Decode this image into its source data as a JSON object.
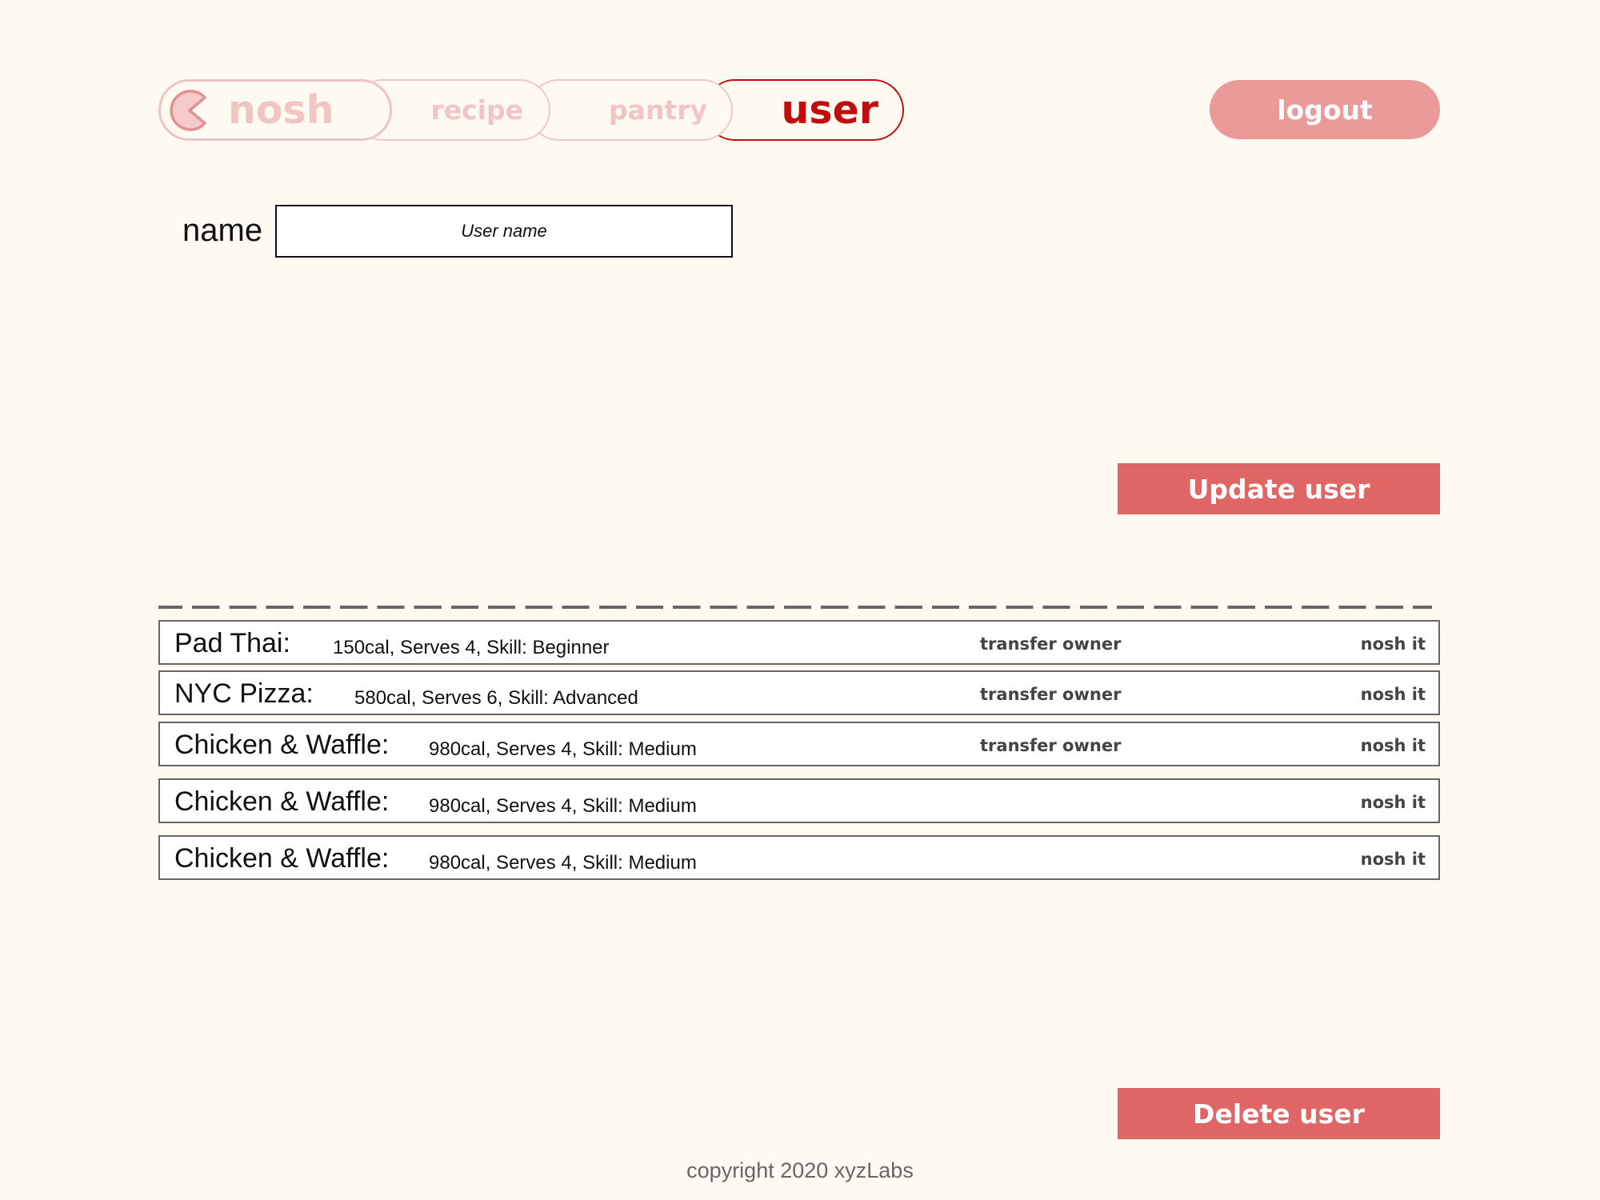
{
  "nav": {
    "home_label": "nosh",
    "recipe_label": "recipe",
    "pantry_label": "pantry",
    "user_label": "user",
    "logo_icon": "pacman-logo-icon",
    "active_color": "#c10d0d",
    "inactive_color": "#f2c5c5"
  },
  "header": {
    "logout_label": "logout",
    "logout_color": "#eb9a9a"
  },
  "form": {
    "name_label": "name",
    "name_placeholder": "User name",
    "name_value": ""
  },
  "actions": {
    "update_label": "Update user",
    "delete_label": "Delete user",
    "button_color": "#e06666"
  },
  "recipes": [
    {
      "title": "Pad Thai:",
      "meta": "150cal, Serves 4, Skill: Beginner",
      "transfer": "transfer owner",
      "nosh": "nosh it"
    },
    {
      "title": "NYC Pizza:",
      "meta": "580cal, Serves 6, Skill: Advanced",
      "transfer": "transfer owner",
      "nosh": "nosh it"
    },
    {
      "title": "Chicken & Waffle:",
      "meta": "980cal, Serves 4, Skill: Medium",
      "transfer": "transfer owner",
      "nosh": "nosh it"
    },
    {
      "title": "Chicken & Waffle:",
      "meta": "980cal, Serves 4, Skill: Medium",
      "nosh": "nosh it"
    },
    {
      "title": "Chicken & Waffle:",
      "meta": "980cal, Serves 4, Skill: Medium",
      "nosh": "nosh it"
    }
  ],
  "footer": {
    "copyright": "copyright 2020 xyzLabs"
  }
}
